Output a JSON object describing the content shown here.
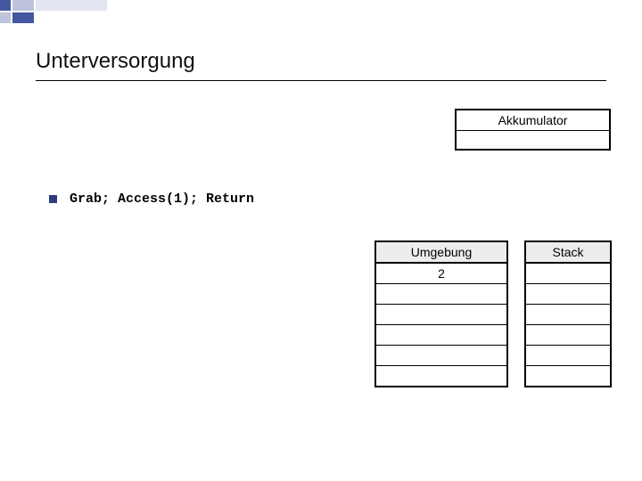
{
  "title": "Unterversorgung",
  "code_line": "Grab; Access(1); Return",
  "accumulator": {
    "label": "Akkumulator",
    "value": ""
  },
  "environment": {
    "label": "Umgebung",
    "cells": [
      "2",
      "",
      "",
      "",
      "",
      ""
    ]
  },
  "stack": {
    "label": "Stack",
    "cells": [
      "",
      "",
      "",
      "",
      "",
      ""
    ]
  }
}
